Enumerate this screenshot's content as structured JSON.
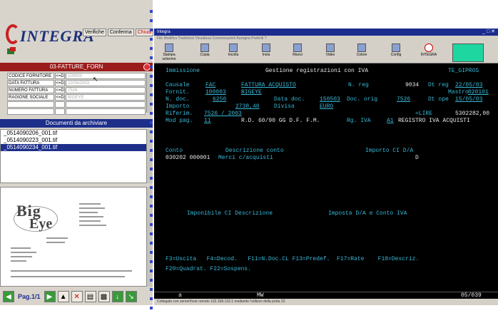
{
  "left_panel": {
    "logo_text": "INTEGRA",
    "buttons": [
      "Verifiche",
      "Conferma",
      "Chiudi"
    ],
    "fatture_title": "03-FATTURE_FORN",
    "fields": [
      {
        "label": "CODICE FORNITORE",
        "op": "<=D",
        "value": "100003"
      },
      {
        "label": "DATA FATTURA",
        "op": "<=D",
        "value": "22/05/2003"
      },
      {
        "label": "NUMERO FATTURA",
        "op": "<=D",
        "value": "7526"
      },
      {
        "label": "RAGIONE SOCIALE",
        "op": "<=D",
        "value": "BIGEYE"
      },
      {
        "label": "",
        "op": "",
        "value": ""
      },
      {
        "label": "",
        "op": "",
        "value": ""
      }
    ],
    "docs_title": "Documenti da archiviare",
    "documents": [
      "_0514090206_001.tif",
      "_0514090223_001.tif",
      "_0514090234_001.tif"
    ],
    "preview": {
      "logo_big": "Big",
      "logo_eye": "Eye"
    },
    "page_label": "Pag.1/1"
  },
  "window": {
    "title": "Integra",
    "menu": "File  Modifica  Trasferisci  Visualizza  Comunicazioni  Assegna  Preferiti  ?",
    "toolbar": [
      {
        "label": "Stampa schermo"
      },
      {
        "label": "Copia"
      },
      {
        "label": "Incolla"
      },
      {
        "label": "Invia"
      },
      {
        "label": "Ricevi"
      },
      {
        "label": "Video"
      },
      {
        "label": "Colore"
      },
      {
        "label": "Config"
      },
      {
        "label": "INTEGRA"
      }
    ],
    "footer": "Collegato con server/host remoto 192.168.133.1 mediante l'utilizzo della porta 23"
  },
  "terminal": {
    "header_left": "Immissione",
    "header_center": "Gestione registrazioni con IVA",
    "header_right": "TE_GIPROS",
    "causale_label": "Causale",
    "causale_code": "FAC",
    "causale_desc": "FATTURA ACQUISTO",
    "nreg_label": "N. reg",
    "nreg_value": "9034",
    "dtreg_label": "Dt reg",
    "dtreg_value": "22/05/03",
    "fornit_label": "Fornit.",
    "fornit_code": "100003",
    "fornit_name": "BIGEYE",
    "mastro_label": "Mastro",
    "mastro_value": "020101",
    "ndoc_label": "N. doc.",
    "ndoc_value": "6250",
    "datadoc_label": "Data doc.",
    "datadoc_value": "150503",
    "docorig_label": "Doc. orig",
    "docorig_value": "7526",
    "dtope_label": "Dt ope",
    "dtope_value": "15/05/03",
    "importo_label": "Importo",
    "importo_value": "2738,40",
    "divisa_label": "Divisa",
    "divisa_value": "EURO",
    "lire_label": "=LIRE",
    "lire_value": "5302282,00",
    "riferim_label": "Riferim.",
    "riferim_value": "7526 / 2003",
    "modpag_label": "Mod pag.",
    "modpag_code": "11",
    "modpag_desc": "R.D. 60/90 GG D.F. F.M.",
    "rgiva_label": "Rg. IVA",
    "rgiva_code": "A1",
    "rgiva_desc": "REGISTRO IVA ACQUISTI",
    "conto_label": "Conto",
    "descconto_label": "Descrizione conto",
    "importo_cd_label": "Importo CI D/A",
    "row_conto": "030202 000001",
    "row_desc": "Merci c/acquisti",
    "row_da": "D",
    "imponibile_label": "Imponibile CI Descrizione",
    "imposta_label": "Imposta D/A e Conto IVA",
    "fkeys_line1": "F3=Uscita   F4=Decod.   F11=N.Doc.CL F13=Predef.  F17=Rate    F18=Descriz.",
    "fkeys_line2": "F20=Quadrat. F22=Sospens.",
    "status_left": "a",
    "status_mid": "MW",
    "status_right": "05/039"
  }
}
